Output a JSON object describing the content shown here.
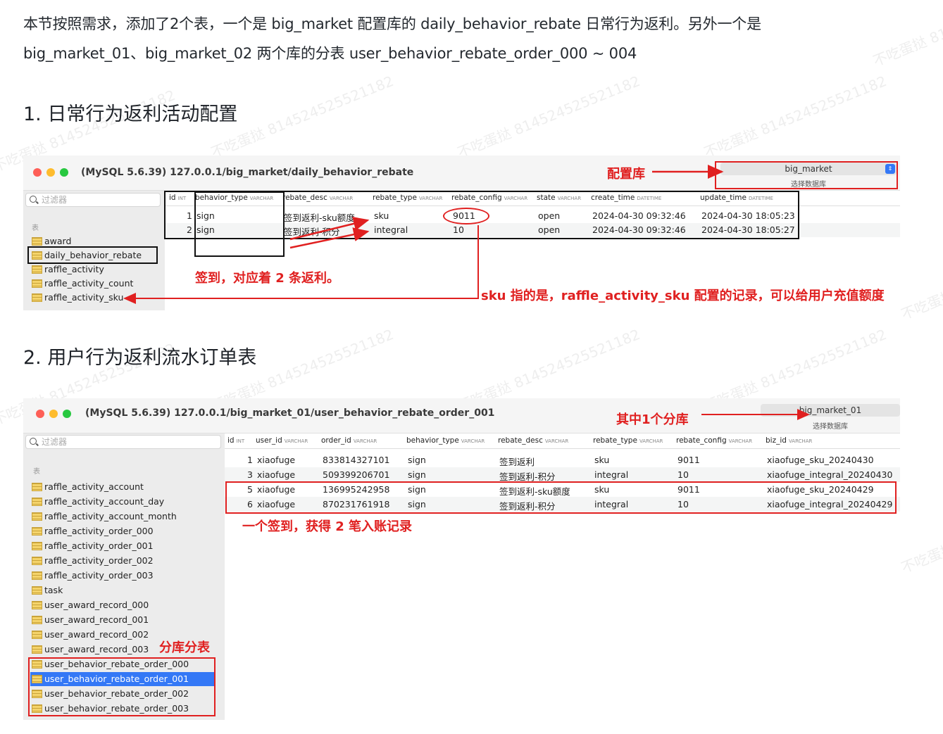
{
  "intro": {
    "line1": "本节按照需求，添加了2个表，一个是 big_market 配置库的 daily_behavior_rebate 日常行为返利。另外一个是",
    "line2": "big_market_01、big_market_02 两个库的分表 user_behavior_rebate_order_000 ~ 004"
  },
  "watermark": "不吃蛋挞 814524525521182",
  "section1": {
    "heading": "1. 日常行为返利活动配置",
    "window_title": "(MySQL 5.6.39) 127.0.0.1/big_market/daily_behavior_rebate",
    "db_select": "big_market",
    "db_caption": "选择数据库",
    "filter_placeholder": "过滤器",
    "tables_label": "表",
    "tables": [
      "award",
      "daily_behavior_rebate",
      "raffle_activity",
      "raffle_activity_count",
      "raffle_activity_sku"
    ],
    "columns": [
      {
        "name": "id",
        "type": "INT"
      },
      {
        "name": "behavior_type",
        "type": "VARCHAR"
      },
      {
        "name": "rebate_desc",
        "type": "VARCHAR"
      },
      {
        "name": "rebate_type",
        "type": "VARCHAR"
      },
      {
        "name": "rebate_config",
        "type": "VARCHAR"
      },
      {
        "name": "state",
        "type": "VARCHAR"
      },
      {
        "name": "create_time",
        "type": "DATETIME"
      },
      {
        "name": "update_time",
        "type": "DATETIME"
      }
    ],
    "rows": [
      [
        "1",
        "sign",
        "签到返利-sku额度",
        "sku",
        "9011",
        "open",
        "2024-04-30 09:32:46",
        "2024-04-30 18:05:23"
      ],
      [
        "2",
        "sign",
        "签到返利-积分",
        "integral",
        "10",
        "open",
        "2024-04-30 09:32:46",
        "2024-04-30 18:05:27"
      ]
    ],
    "annotations": {
      "config_db": "配置库",
      "sign_two": "签到，对应着 2 条返利。",
      "sku_note": "sku 指的是，raffle_activity_sku 配置的记录，可以给用户充值额度"
    }
  },
  "section2": {
    "heading": "2. 用户行为返利流水订单表",
    "window_title": "(MySQL 5.6.39) 127.0.0.1/big_market_01/user_behavior_rebate_order_001",
    "db_select": "big_market_01",
    "db_caption": "选择数据库",
    "filter_placeholder": "过滤器",
    "tables_label": "表",
    "tables": [
      "raffle_activity_account",
      "raffle_activity_account_day",
      "raffle_activity_account_month",
      "raffle_activity_order_000",
      "raffle_activity_order_001",
      "raffle_activity_order_002",
      "raffle_activity_order_003",
      "task",
      "user_award_record_000",
      "user_award_record_001",
      "user_award_record_002",
      "user_award_record_003",
      "user_behavior_rebate_order_000",
      "user_behavior_rebate_order_001",
      "user_behavior_rebate_order_002",
      "user_behavior_rebate_order_003"
    ],
    "selected_table": "user_behavior_rebate_order_001",
    "columns": [
      {
        "name": "id",
        "type": "INT"
      },
      {
        "name": "user_id",
        "type": "VARCHAR"
      },
      {
        "name": "order_id",
        "type": "VARCHAR"
      },
      {
        "name": "behavior_type",
        "type": "VARCHAR"
      },
      {
        "name": "rebate_desc",
        "type": "VARCHAR"
      },
      {
        "name": "rebate_type",
        "type": "VARCHAR"
      },
      {
        "name": "rebate_config",
        "type": "VARCHAR"
      },
      {
        "name": "biz_id",
        "type": "VARCHAR"
      }
    ],
    "rows": [
      [
        "1",
        "xiaofuge",
        "833814327101",
        "sign",
        "签到返利",
        "sku",
        "9011",
        "xiaofuge_sku_20240430"
      ],
      [
        "3",
        "xiaofuge",
        "509399206701",
        "sign",
        "签到返利-积分",
        "integral",
        "10",
        "xiaofuge_integral_20240430"
      ],
      [
        "5",
        "xiaofuge",
        "136995242958",
        "sign",
        "签到返利-sku额度",
        "sku",
        "9011",
        "xiaofuge_sku_20240429"
      ],
      [
        "6",
        "xiaofuge",
        "870231761918",
        "sign",
        "签到返利-积分",
        "integral",
        "10",
        "xiaofuge_integral_20240429"
      ]
    ],
    "annotations": {
      "one_shard": "其中1个分库",
      "one_sign_two": "一个签到，获得 2 笔入账记录",
      "sharding": "分库分表"
    }
  },
  "colors": {
    "annotation": "#e02020",
    "selection": "#3478f6"
  }
}
